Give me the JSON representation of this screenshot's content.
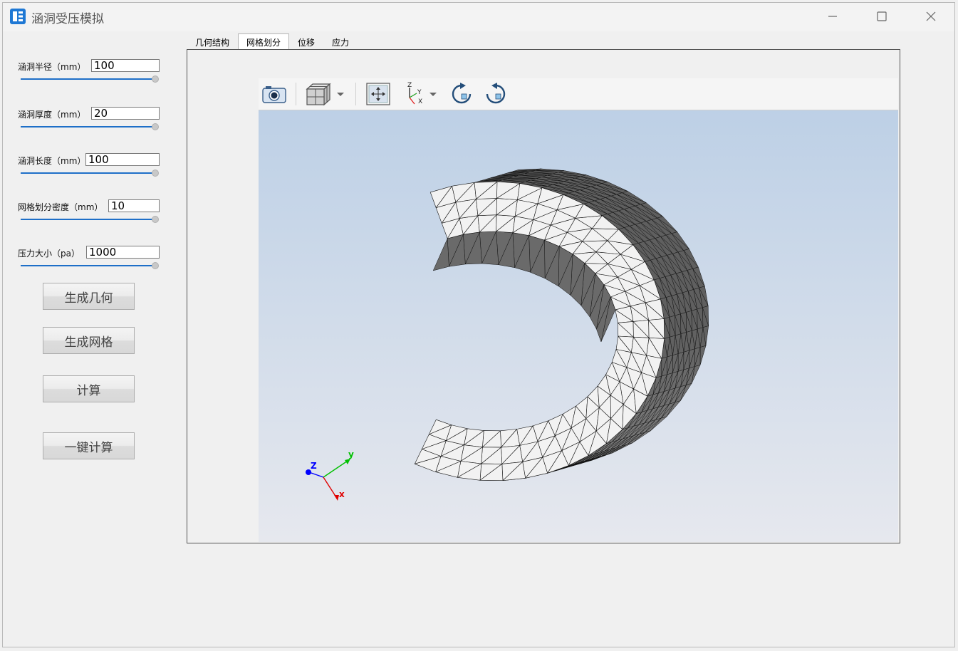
{
  "window": {
    "title": "涵洞受压模拟",
    "icon": "app-icon",
    "controls": {
      "minimize": "minimize-icon",
      "maximize": "maximize-icon",
      "close": "close-icon"
    }
  },
  "params": [
    {
      "label": "涵洞半径（mm）",
      "value": "100",
      "slider": 1.0
    },
    {
      "label": "涵洞厚度（mm）",
      "value": "20",
      "slider": 1.0
    },
    {
      "label": "涵洞长度（mm）",
      "value": "100",
      "slider": 1.0
    },
    {
      "label": "网格划分密度（mm）",
      "value": "10",
      "slider": 1.0
    },
    {
      "label": "压力大小（pa）",
      "value": "1000",
      "slider": 1.0
    }
  ],
  "buttons": {
    "generate_geometry": "生成几何",
    "generate_mesh": "生成网格",
    "compute": "计算",
    "one_click_compute": "一键计算"
  },
  "tabs": [
    {
      "label": "几何结构",
      "active": false
    },
    {
      "label": "网格划分",
      "active": true
    },
    {
      "label": "位移",
      "active": false
    },
    {
      "label": "应力",
      "active": false
    }
  ],
  "viewer": {
    "toolbar_icons": [
      "camera-icon",
      "cube-view-icon",
      "dropdown-arrow-icon",
      "fit-view-icon",
      "axes-orientation-icon",
      "dropdown-arrow-icon",
      "rotate-cw-icon",
      "rotate-ccw-icon"
    ],
    "axes_toolbar_labels": {
      "z": "Z",
      "y": "Y",
      "x": "X"
    },
    "triad_labels": {
      "z": "Z",
      "y": "y",
      "x": "x"
    },
    "colors": {
      "background_top": "#bdd0e6",
      "background_bottom": "#e6e8ee",
      "mesh_face": "#f2f2f2",
      "mesh_dark": "#6a6a6a",
      "x_axis": "#ff0000",
      "y_axis": "#00c000",
      "z_axis": "#0000ff"
    }
  }
}
